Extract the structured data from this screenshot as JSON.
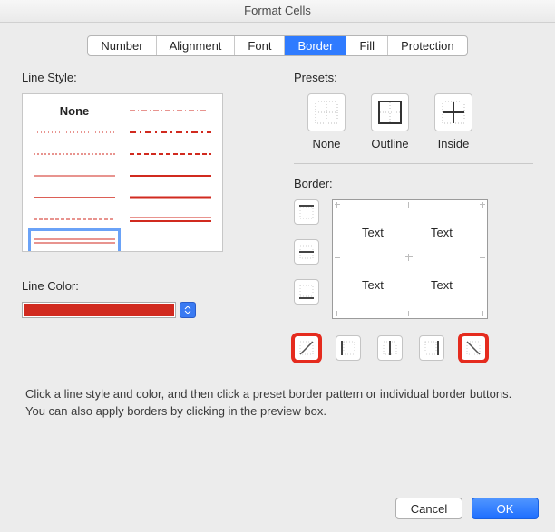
{
  "title": "Format Cells",
  "tabs": [
    "Number",
    "Alignment",
    "Font",
    "Border",
    "Fill",
    "Protection"
  ],
  "active_tab_index": 3,
  "line_style_label": "Line Style:",
  "line_style_none": "None",
  "line_color_label": "Line Color:",
  "line_color_hex": "#d12a1f",
  "selected_line_style_index": 12,
  "presets_label": "Presets:",
  "presets": {
    "none": "None",
    "outline": "Outline",
    "inside": "Inside"
  },
  "border_label": "Border:",
  "preview_cells": {
    "tl": "Text",
    "tr": "Text",
    "bl": "Text",
    "br": "Text"
  },
  "instruction": "Click a line style and color, and then click a preset border pattern or individual border buttons. You can also apply borders by clicking in the preview box.",
  "buttons": {
    "cancel": "Cancel",
    "ok": "OK"
  }
}
